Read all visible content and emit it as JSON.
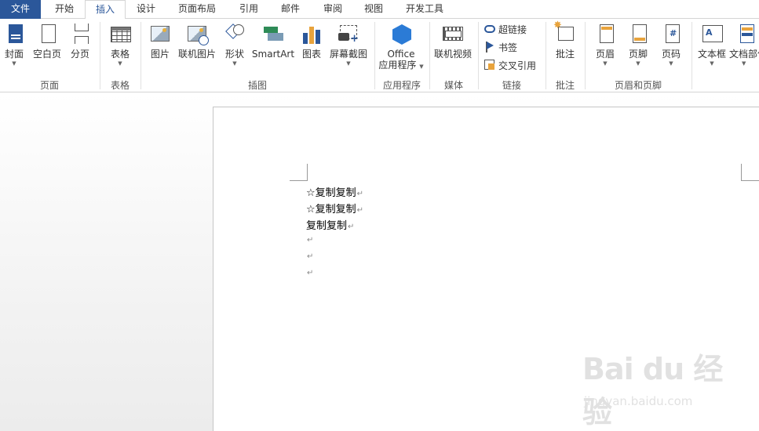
{
  "tabs": {
    "file": "文件",
    "home": "开始",
    "insert": "插入",
    "design": "设计",
    "layout": "页面布局",
    "references": "引用",
    "mailings": "邮件",
    "review": "审阅",
    "view": "视图",
    "developer": "开发工具"
  },
  "ribbon": {
    "pages": {
      "label": "页面",
      "cover": "封面",
      "blank": "空白页",
      "break": "分页"
    },
    "tables": {
      "label": "表格",
      "table": "表格"
    },
    "illustrations": {
      "label": "插图",
      "picture": "图片",
      "online_picture": "联机图片",
      "shapes": "形状",
      "smartart": "SmartArt",
      "chart": "图表",
      "screenshot": "屏幕截图"
    },
    "apps": {
      "label": "应用程序",
      "office_line1": "Office",
      "office_line2": "应用程序"
    },
    "media": {
      "label": "媒体",
      "online_video": "联机视频"
    },
    "links": {
      "label": "链接",
      "hyperlink": "超链接",
      "bookmark": "书签",
      "cross_ref": "交叉引用"
    },
    "comments": {
      "label": "批注",
      "comment": "批注"
    },
    "header_footer": {
      "label": "页眉和页脚",
      "header": "页眉",
      "footer": "页脚",
      "page_number": "页码"
    },
    "text": {
      "textbox": "文本框",
      "quickparts": "文档部件"
    }
  },
  "document": {
    "lines": [
      "☆复制复制",
      "☆复制复制",
      "复制复制",
      "",
      "",
      ""
    ],
    "paragraph_mark": "↵"
  },
  "watermark": {
    "brand": "Bai du 经验",
    "url": "jingyan.baidu.com"
  },
  "colors": {
    "accent": "#2b579a"
  }
}
